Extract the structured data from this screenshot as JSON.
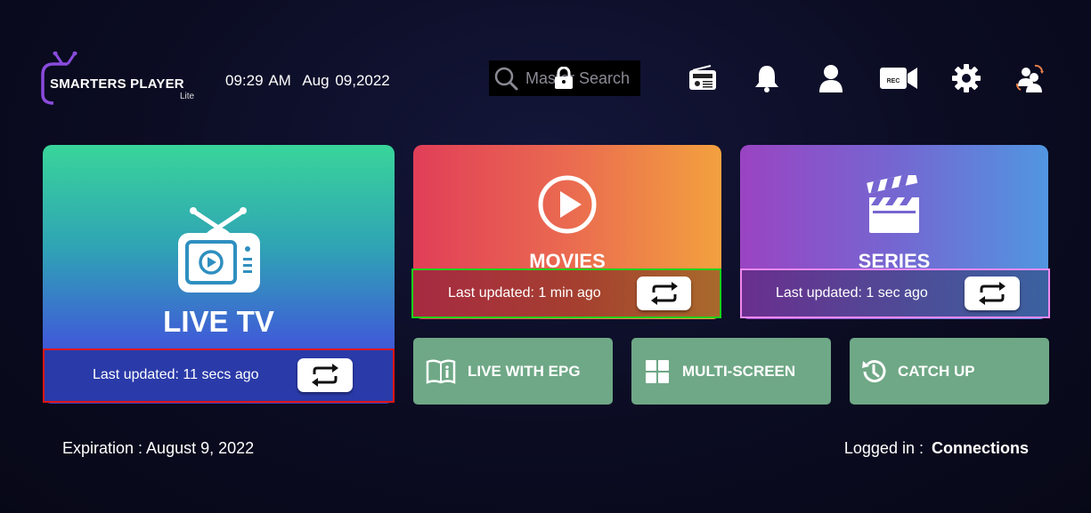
{
  "app": {
    "name": "SMARTERS PLAYER",
    "edition": "Lite"
  },
  "header": {
    "time": "09:29 AM",
    "date": "Aug 09,2022",
    "search_placeholder": "Master Search",
    "icons": [
      "radio-icon",
      "bell-icon",
      "user-icon",
      "rec-icon",
      "gear-icon",
      "switch-user-icon"
    ],
    "rec_label": "REC"
  },
  "cards": {
    "live_tv": {
      "title": "LIVE TV",
      "last_updated": "Last updated: 11 secs ago"
    },
    "movies": {
      "title": "MOVIES",
      "last_updated": "Last updated: 1 min ago"
    },
    "series": {
      "title": "SERIES",
      "last_updated": "Last updated: 1 sec ago"
    }
  },
  "shortcuts": [
    {
      "label": "LIVE WITH EPG",
      "icon": "book-info-icon"
    },
    {
      "label": "MULTI-SCREEN",
      "icon": "grid-icon"
    },
    {
      "label": "CATCH UP",
      "icon": "history-icon"
    }
  ],
  "footer": {
    "expiration": "Expiration : August 9, 2022",
    "logged_in_label": "Logged in :",
    "logged_in_user": "Connections"
  },
  "colors": {
    "shortcut_bg": "#6fa886",
    "live_highlight": "#e01515",
    "movies_highlight": "#19d21a",
    "series_highlight": "#f089f0"
  }
}
